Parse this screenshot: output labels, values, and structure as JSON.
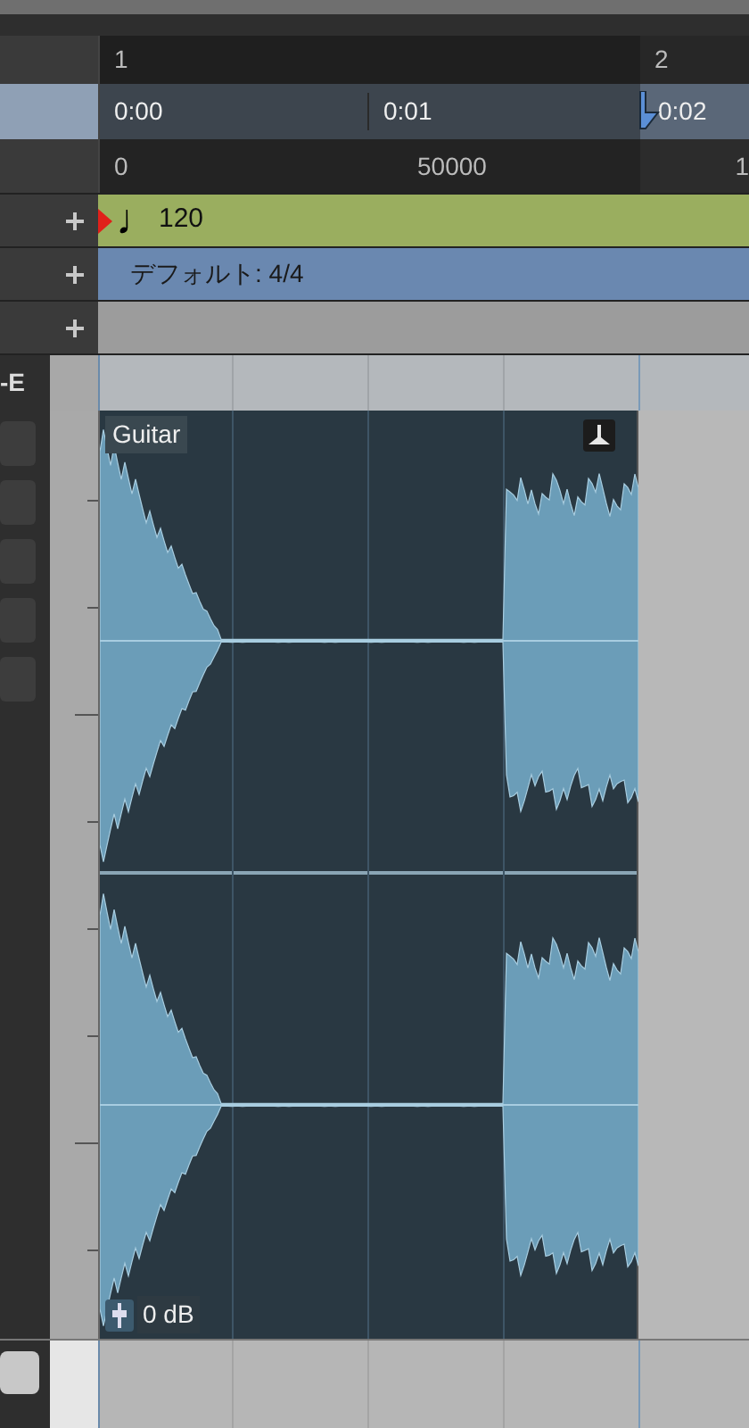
{
  "ruler": {
    "bars": [
      "1",
      "2"
    ],
    "times": [
      "0:00",
      "0:01",
      "0:02"
    ],
    "samples": [
      "0",
      "50000",
      "1"
    ]
  },
  "tracks": [
    {
      "kind": "tempo",
      "note": "♩",
      "label": "120"
    },
    {
      "kind": "signature",
      "label": "デフォルト: 4/4"
    },
    {
      "kind": "empty"
    }
  ],
  "header_label": "-E",
  "event": {
    "name": "Guitar",
    "gain": "0 dB"
  }
}
